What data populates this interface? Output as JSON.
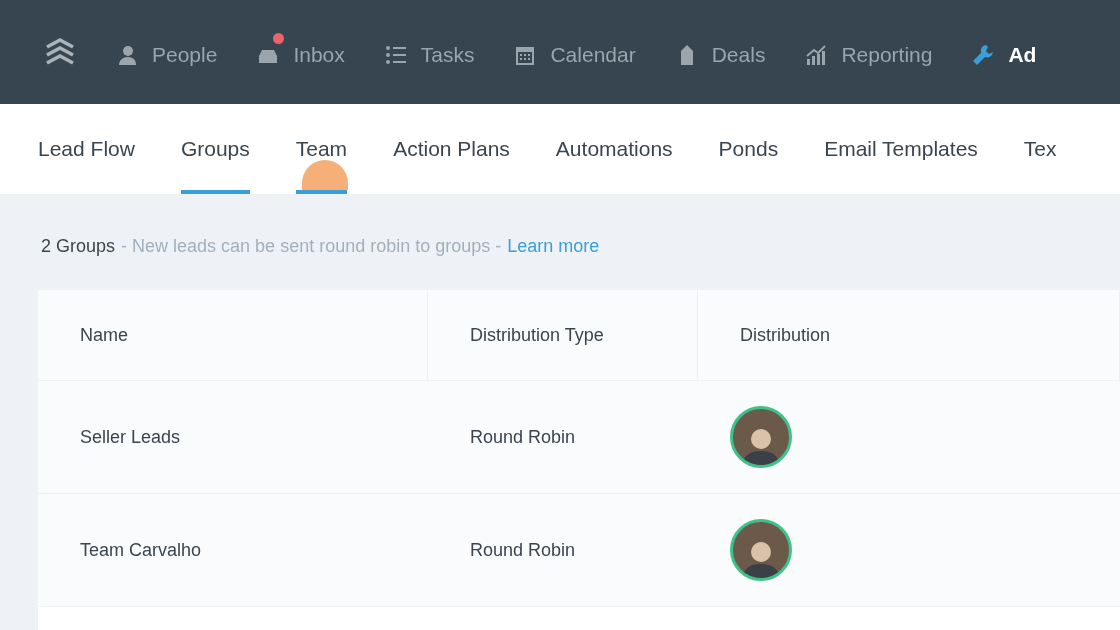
{
  "top_nav": {
    "items": [
      {
        "label": "People",
        "kind": "people",
        "selected": false,
        "badge": false
      },
      {
        "label": "Inbox",
        "kind": "inbox",
        "selected": false,
        "badge": true
      },
      {
        "label": "Tasks",
        "kind": "tasks",
        "selected": false,
        "badge": false
      },
      {
        "label": "Calendar",
        "kind": "calendar",
        "selected": false,
        "badge": false
      },
      {
        "label": "Deals",
        "kind": "deals",
        "selected": false,
        "badge": false
      },
      {
        "label": "Reporting",
        "kind": "reporting",
        "selected": false,
        "badge": false
      },
      {
        "label": "Ad",
        "kind": "admin",
        "selected": true,
        "badge": false
      }
    ]
  },
  "sub_tabs": [
    {
      "label": "Lead Flow",
      "selected": false,
      "clicked": false
    },
    {
      "label": "Groups",
      "selected": true,
      "clicked": false
    },
    {
      "label": "Team",
      "selected": true,
      "clicked": true
    },
    {
      "label": "Action Plans",
      "selected": false,
      "clicked": false
    },
    {
      "label": "Automations",
      "selected": false,
      "clicked": false
    },
    {
      "label": "Ponds",
      "selected": false,
      "clicked": false
    },
    {
      "label": "Email Templates",
      "selected": false,
      "clicked": false
    },
    {
      "label": "Tex",
      "selected": false,
      "clicked": false
    }
  ],
  "info": {
    "count": "2 Groups",
    "hint": "- New leads can be sent round robin to groups -",
    "link": "Learn more"
  },
  "table": {
    "columns": [
      "Name",
      "Distribution Type",
      "Distribution"
    ],
    "rows": [
      {
        "name": "Seller Leads",
        "distribution_type": "Round Robin"
      },
      {
        "name": "Team Carvalho",
        "distribution_type": "Round Robin"
      }
    ]
  }
}
